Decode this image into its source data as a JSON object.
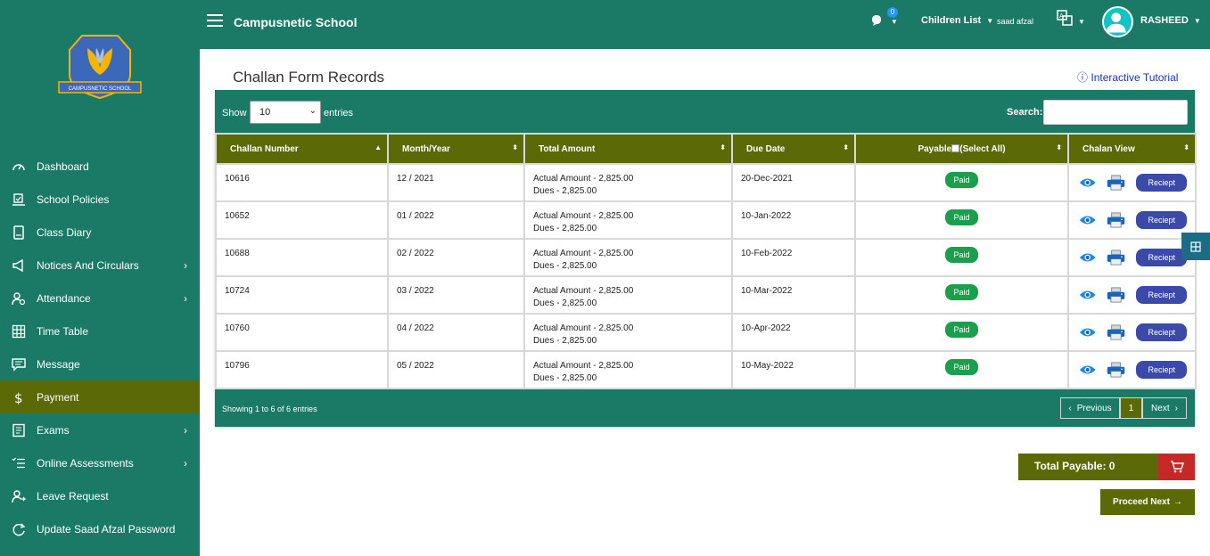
{
  "app": {
    "title": "Campusnetic School",
    "logo_text": "CAMPUSNETIC SCHOOL"
  },
  "topbar": {
    "notification_count": "0",
    "children_list_label": "Children List",
    "student_name": "saad afzal",
    "user_name": "RASHEED"
  },
  "sidebar": {
    "items": [
      {
        "label": "Dashboard",
        "icon": "gauge-icon",
        "has_chevron": false
      },
      {
        "label": "School Policies",
        "icon": "policy-icon",
        "has_chevron": false
      },
      {
        "label": "Class Diary",
        "icon": "diary-icon",
        "has_chevron": false
      },
      {
        "label": "Notices And Circulars",
        "icon": "megaphone-icon",
        "has_chevron": true
      },
      {
        "label": "Attendance",
        "icon": "attendance-icon",
        "has_chevron": true
      },
      {
        "label": "Time Table",
        "icon": "grid-icon",
        "has_chevron": false
      },
      {
        "label": "Message",
        "icon": "message-icon",
        "has_chevron": false
      },
      {
        "label": "Payment",
        "icon": "dollar-icon",
        "has_chevron": false,
        "active": true
      },
      {
        "label": "Exams",
        "icon": "exam-icon",
        "has_chevron": true
      },
      {
        "label": "Online Assessments",
        "icon": "checklist-icon",
        "has_chevron": true
      },
      {
        "label": "Leave Request",
        "icon": "leave-icon",
        "has_chevron": false
      },
      {
        "label": "Update Saad Afzal Password",
        "icon": "password-icon",
        "has_chevron": false
      }
    ]
  },
  "page": {
    "title": "Challan Form Records",
    "tutorial_label": "Interactive Tutorial"
  },
  "table_controls": {
    "show_label": "Show",
    "page_size": "10",
    "entries_label": "entries",
    "search_label": "Search:",
    "search_value": ""
  },
  "table": {
    "headers": [
      "Challan Number",
      "Month/Year",
      "Total Amount",
      "Due Date",
      "Payable",
      "(Select All)",
      "Chalan View"
    ],
    "rows": [
      {
        "number": "10616",
        "month": "12 / 2021",
        "actual": "Actual Amount - 2,825.00",
        "dues": "Dues - 2,825.00",
        "due_date": "20-Dec-2021",
        "status": "Paid",
        "receipt": "Reciept"
      },
      {
        "number": "10652",
        "month": "01 / 2022",
        "actual": "Actual Amount - 2,825.00",
        "dues": "Dues - 2,825.00",
        "due_date": "10-Jan-2022",
        "status": "Paid",
        "receipt": "Reciept"
      },
      {
        "number": "10688",
        "month": "02 / 2022",
        "actual": "Actual Amount - 2,825.00",
        "dues": "Dues - 2,825.00",
        "due_date": "10-Feb-2022",
        "status": "Paid",
        "receipt": "Reciept"
      },
      {
        "number": "10724",
        "month": "03 / 2022",
        "actual": "Actual Amount - 2,825.00",
        "dues": "Dues - 2,825.00",
        "due_date": "10-Mar-2022",
        "status": "Paid",
        "receipt": "Reciept"
      },
      {
        "number": "10760",
        "month": "04 / 2022",
        "actual": "Actual Amount - 2,825.00",
        "dues": "Dues - 2,825.00",
        "due_date": "10-Apr-2022",
        "status": "Paid",
        "receipt": "Reciept"
      },
      {
        "number": "10796",
        "month": "05 / 2022",
        "actual": "Actual Amount - 2,825.00",
        "dues": "Dues - 2,825.00",
        "due_date": "10-May-2022",
        "status": "Paid",
        "receipt": "Reciept"
      }
    ]
  },
  "footer": {
    "info": "Showing 1 to 6 of 6 entries",
    "previous_label": "Previous",
    "current_page": "1",
    "next_label": "Next"
  },
  "summary": {
    "total_payable_label": "Total Payable: 0",
    "proceed_label": "Proceed Next"
  },
  "colors": {
    "primary": "#1b7a66",
    "active": "#5b6a06",
    "paid_badge": "#1aa04d",
    "receipt_button": "#3b4aa8",
    "cart": "#c62828"
  }
}
